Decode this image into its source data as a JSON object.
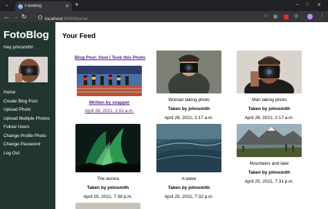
{
  "browser": {
    "tab_title": "FotoBlog",
    "url_host": "localhost",
    "url_path": ":8000/home/"
  },
  "sidebar": {
    "brand": "FotoBlog",
    "greeting": "Hey johnsmith!",
    "links": [
      "Home",
      "Create Blog Post",
      "Upload Photo",
      "Upload Multiple Photos",
      "Follow Users",
      "Change Profile Photo",
      "Change Password",
      "Log Out"
    ]
  },
  "feed": {
    "title": "Your Feed",
    "blog_post": {
      "title": "Blog Post: How I Took this Photo",
      "author": "Written by snapper",
      "date": "April 28, 2021, 1:02 a.m."
    },
    "photos": [
      {
        "caption": "Woman taking photo",
        "taken_by": "Taken by johnsmith",
        "date": "April 26, 2021, 2:17 a.m."
      },
      {
        "caption": "Man taking photo",
        "taken_by": "Taken by johnsmith",
        "date": "April 26, 2021, 2:17 a.m."
      },
      {
        "caption": "The aurora",
        "taken_by": "Taken by johnsmith",
        "date": "April 25, 2021, 7:38 p.m."
      },
      {
        "caption": "A wave",
        "taken_by": "Taken by johnsmith",
        "date": "April 25, 2021, 7:32 p.m."
      },
      {
        "caption": "Mountains and lake",
        "taken_by": "Taken by johnsmith",
        "date": "April 25, 2021, 7:31 p.m."
      }
    ]
  },
  "colors": {
    "sidebar_bg": "#22362f",
    "link_visited": "#551a8b",
    "chrome_dark": "#202124"
  }
}
